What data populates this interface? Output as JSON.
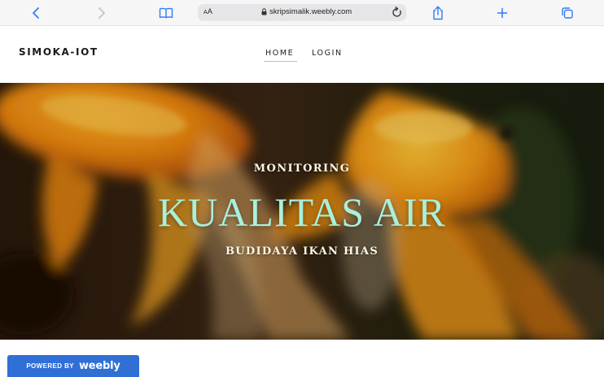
{
  "browser": {
    "text_size_label": "AA",
    "url": "skripsimalik.weebly.com",
    "accent_color": "#2f7cf6"
  },
  "site": {
    "brand": "SIMOKA-IOT",
    "nav": [
      {
        "label": "HOME"
      },
      {
        "label": "LOGIN"
      }
    ]
  },
  "hero": {
    "kicker": "MONITORING",
    "title": "KUALITAS AIR",
    "subtitle": "BUDIDAYA IKAN HIAS"
  },
  "badge": {
    "prefix": "POWERED BY",
    "brand": "weebly",
    "color": "#2f6fd6"
  }
}
